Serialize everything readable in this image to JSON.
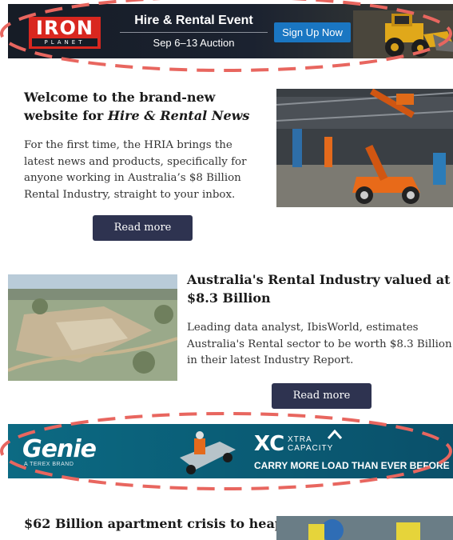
{
  "banner_top": {
    "logo_main": "IRON",
    "logo_sub": "PLANET",
    "title": "Hire & Rental Event",
    "subtitle": "Sep 6–13 Auction",
    "cta": "Sign Up Now"
  },
  "articles": [
    {
      "title_lead": "Welcome to the brand-new website for ",
      "title_em": "Hire & Rental News",
      "body": "For the first time, the HRIA brings the latest news and products, specifically for anyone working in Australia’s $8 Billion Rental Industry, straight to your inbox.",
      "button": "Read more"
    },
    {
      "title": "Australia's Rental Industry valued at $8.3 Billion",
      "body": "Leading data analyst, IbisWorld, estimates Australia's Rental sector to be worth $8.3 Billion in their latest Industry Report.",
      "button": "Read more"
    },
    {
      "title": "$62 Billion apartment crisis to heap"
    }
  ],
  "banner_bottom": {
    "brand": "Genie",
    "brand_sub": "A TEREX BRAND",
    "product": "XC",
    "product_line1": "XTRA",
    "product_line2": "CAPACITY",
    "tagline": "CARRY MORE LOAD THAN EVER BEFORE"
  },
  "colors": {
    "button_bg": "#2e3350",
    "cta_blue": "#1a76c2",
    "iron_red": "#d9271f",
    "genie_teal": "#0c6a83",
    "annotation_dash": "#e8665f"
  }
}
